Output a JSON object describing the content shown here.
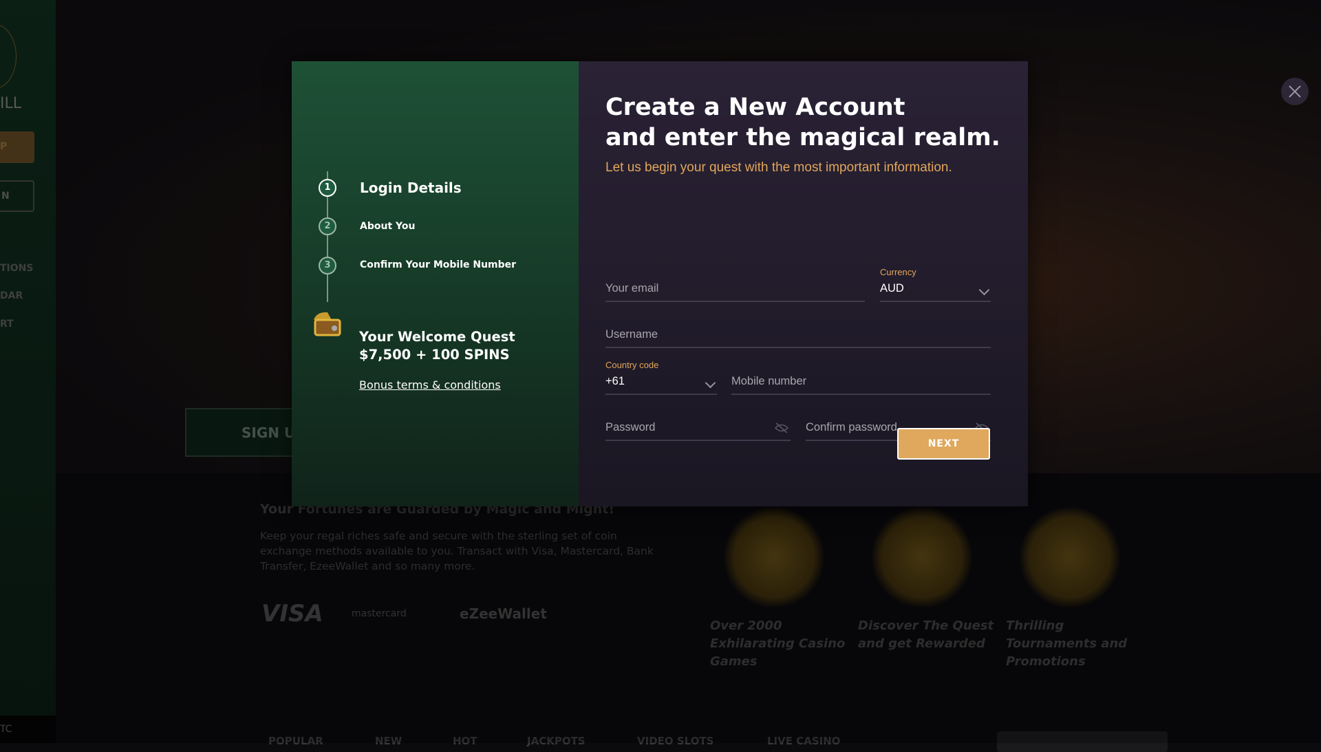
{
  "background": {
    "sidebar": {
      "logo_text": "ILL",
      "signup_btn": "P",
      "login_btn": "N",
      "items": [
        "TIONS",
        "DAR",
        "RT"
      ],
      "footer": "TC"
    },
    "hero_signup": "SIGN U",
    "fortunes": {
      "heading": "Your Fortunes are Guarded by Magic and Might!",
      "text": "Keep your regal riches safe and secure with the sterling set of coin exchange methods available to you. Transact with Visa, Mastercard, Bank Transfer, EzeeWallet and so many more.",
      "payments": [
        "VISA",
        "mastercard",
        "eZeeWallet"
      ]
    },
    "features": [
      "Over 2000 Exhilarating Casino Games",
      "Discover The Quest and get Rewarded",
      "Thrilling Tournaments and Promotions"
    ],
    "nav": [
      "POPULAR",
      "NEW",
      "HOT",
      "JACKPOTS",
      "VIDEO SLOTS",
      "LIVE CASINO"
    ]
  },
  "modal": {
    "steps": [
      {
        "num": "1",
        "label": "Login Details",
        "active": true
      },
      {
        "num": "2",
        "label": "About You"
      },
      {
        "num": "3",
        "label": "Confirm Your Mobile Number"
      }
    ],
    "welcome_line1": "Your Welcome Quest",
    "welcome_line2": "$7,500 + 100 SPINS",
    "bonus_link": "Bonus terms & conditions",
    "title_line1": "Create a New Account",
    "title_line2": "and enter the magical realm.",
    "subtitle": "Let us begin your quest with the most important information.",
    "fields": {
      "email": "Your email",
      "currency_label": "Currency",
      "currency_value": "AUD",
      "username": "Username",
      "country_label": "Country code",
      "country_value": "+61",
      "mobile": "Mobile number",
      "password": "Password",
      "confirm_password": "Confirm password"
    },
    "next": "NEXT"
  },
  "colors": {
    "accent": "#e0a85c",
    "left_panel": "#1e5136",
    "right_panel": "#231d2d"
  }
}
